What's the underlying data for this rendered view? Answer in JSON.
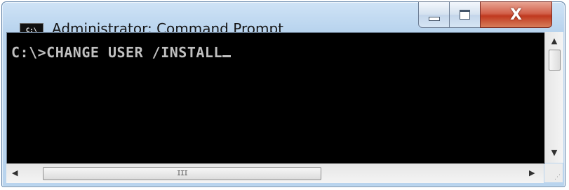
{
  "window": {
    "title": "Administrator: Command Prompt",
    "icon_label": "C:\\",
    "icon_name": "cmd-app-icon"
  },
  "caption_buttons": {
    "minimize_icon": "minimize-icon",
    "maximize_icon": "maximize-icon",
    "close_icon": "close-icon",
    "close_glyph": "X"
  },
  "console": {
    "prompt_line": "C:\\>CHANGE USER /INSTALL",
    "text_color": "#c0c0c0",
    "background": "#000000"
  },
  "scrollbars": {
    "up_arrow": "▲",
    "down_arrow": "▼",
    "left_arrow": "◀",
    "right_arrow": "▶",
    "grip": "III",
    "size_grip": "⋰"
  }
}
